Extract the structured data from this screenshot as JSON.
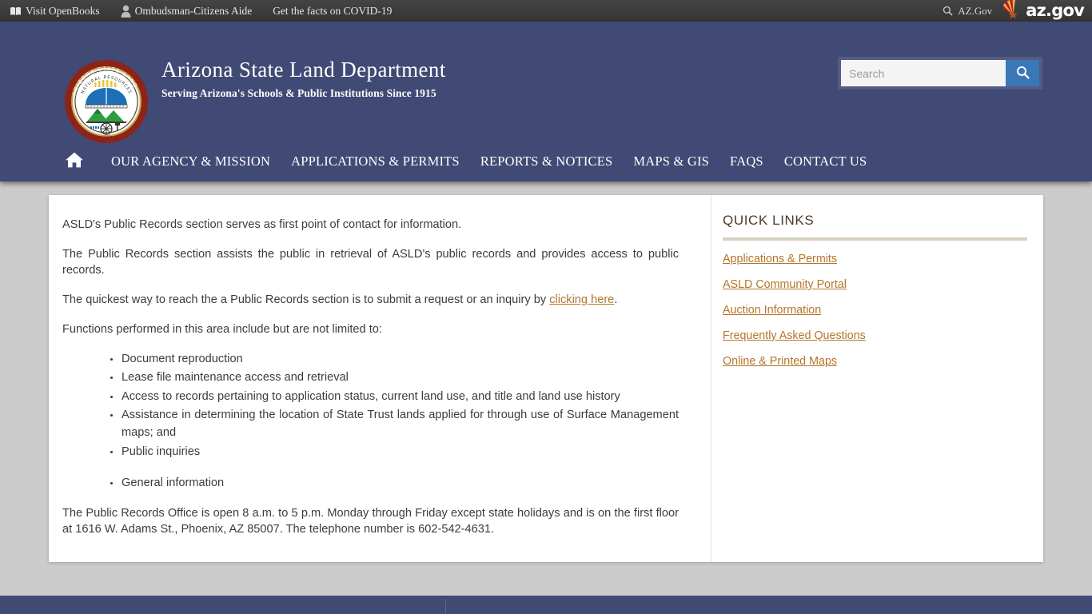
{
  "topbar": {
    "links": [
      {
        "label": "Visit OpenBooks",
        "icon": "open-book-icon"
      },
      {
        "label": "Ombudsman-Citizens Aide",
        "icon": "person-icon"
      },
      {
        "label": "Get the facts on COVID-19",
        "icon": "none"
      }
    ],
    "az_gov_label": "AZ.Gov",
    "az_gov_search_icon": "magnifier-icon",
    "logo_text": "az.gov",
    "background": "#3a3a3a"
  },
  "header": {
    "seal_icon": "arizona-state-land-department-seal",
    "seal_text": {
      "ring_top": "ARIZONA STATE",
      "ring_right": "LAND DEPARTMENT",
      "inner_arc": "NATURAL RESOURCES",
      "year": "1915"
    },
    "title": "Arizona State Land Department",
    "tagline": "Serving Arizona's Schools & Public Institutions Since 1915",
    "background": "#414a75",
    "search": {
      "placeholder": "Search",
      "value": "",
      "button_icon": "search-icon",
      "button_color": "#3a78b5"
    }
  },
  "nav": {
    "home_icon": "home-icon",
    "items": [
      {
        "label": "OUR AGENCY & MISSION"
      },
      {
        "label": "APPLICATIONS & PERMITS"
      },
      {
        "label": "REPORTS & NOTICES"
      },
      {
        "label": "MAPS & GIS"
      },
      {
        "label": "FAQS"
      },
      {
        "label": "CONTACT US"
      }
    ]
  },
  "main": {
    "paragraphs": {
      "p1": "ASLD's Public Records section serves as first point of contact for information.",
      "p2": "The Public Records section assists the public in retrieval of ASLD's public records and provides access to public records.",
      "p3_before": "The quickest way to reach the a Public Records section is to submit a request or an inquiry by ",
      "p3_link": "clicking here",
      "p3_after": ".",
      "p4": "Functions performed in this area include but are not limited to:",
      "p5": "The Public Records Office is open 8 a.m. to 5 p.m. Monday through Friday except state holidays and is on the first floor at 1616 W. Adams St., Phoenix, AZ 85007. The telephone number is 602-542-4631."
    },
    "bullets": [
      "Document reproduction",
      "Lease file maintenance access and retrieval",
      "Access to records pertaining to application status, current land use, and title and land use history",
      "Assistance in determining the location of State Trust lands applied for through use of Surface Management maps; and",
      "Public inquiries",
      "General information"
    ]
  },
  "sidebar": {
    "title": "QUICK LINKS",
    "accent_color": "#b5752a",
    "links": [
      {
        "label": "Applications & Permits"
      },
      {
        "label": "ASLD Community Portal"
      },
      {
        "label": "Auction Information"
      },
      {
        "label": "Frequently Asked Questions"
      },
      {
        "label": "Online & Printed Maps"
      }
    ]
  },
  "footer": {
    "background": "#414a75"
  }
}
